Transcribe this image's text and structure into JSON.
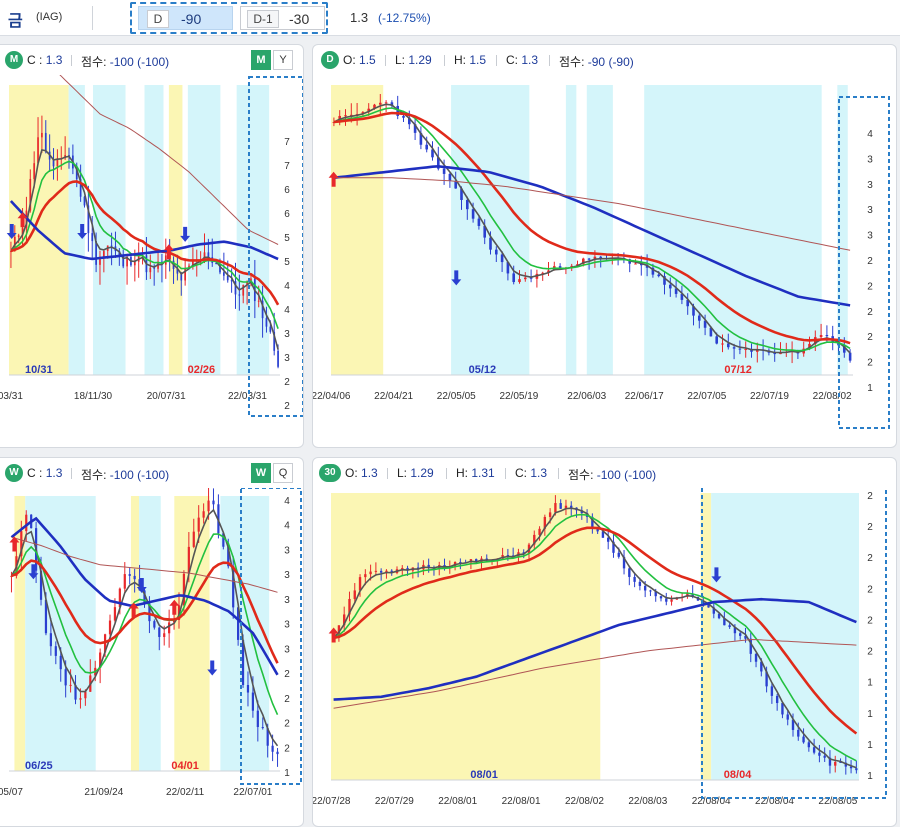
{
  "header": {
    "title": "금",
    "code": "(IAG)",
    "d_label": "D",
    "d_value": "-90",
    "d1_label": "D-1",
    "d1_value": "-30",
    "price": "1.3",
    "change": "(-12.75%)"
  },
  "colors": {
    "badge": "#2aa56b",
    "rise": "#e8282b",
    "fall": "#2a3fd0",
    "highlight_yellow": "#fbf6b4",
    "highlight_cyan": "#d4f5fa",
    "ma_gray": "#555555",
    "ma_green": "#22c040",
    "ma_red": "#e02a1a",
    "ma_blue": "#1f2fc0",
    "ma_brown": "#b05555",
    "dashed_box": "#2a7ec8"
  },
  "panels": {
    "monthly": {
      "badge": "M",
      "c_label": "C :",
      "c_value": "1.3",
      "score_label": "점수:",
      "score_value": "-100 (-100)",
      "btn_active": "M",
      "btn_other": "Y",
      "y_ticks": [
        "7",
        "7",
        "6",
        "6",
        "5",
        "5",
        "4",
        "4",
        "3",
        "3",
        "2",
        "2"
      ],
      "x_ticks": [
        "/03/31",
        "18/11/30",
        "20/07/31",
        "22/03/31"
      ],
      "markers": [
        {
          "text": "10/31",
          "color": "fall"
        },
        {
          "text": "02/26",
          "color": "rise"
        }
      ]
    },
    "daily": {
      "badge": "D",
      "o_label": "O:",
      "o_value": "1.5",
      "l_label": "L:",
      "l_value": "1.29",
      "h_label": "H:",
      "h_value": "1.5",
      "c_label": "C:",
      "c_value": "1.3",
      "score_label": "점수:",
      "score_value": "-90 (-90)",
      "y_ticks": [
        "4",
        "3",
        "3",
        "3",
        "3",
        "2",
        "2",
        "2",
        "2",
        "2",
        "1"
      ],
      "x_ticks": [
        "22/04/06",
        "22/04/21",
        "22/05/05",
        "22/05/19",
        "22/06/03",
        "22/06/17",
        "22/07/05",
        "22/07/19",
        "22/08/02"
      ],
      "markers": [
        {
          "text": "05/12",
          "color": "fall"
        },
        {
          "text": "07/12",
          "color": "rise"
        }
      ]
    },
    "weekly": {
      "badge": "W",
      "c_label": "C :",
      "c_value": "1.3",
      "score_label": "점수:",
      "score_value": "-100 (-100)",
      "btn_active": "W",
      "btn_other": "Q",
      "y_ticks": [
        "4",
        "4",
        "3",
        "3",
        "3",
        "3",
        "3",
        "2",
        "2",
        "2",
        "2",
        "1"
      ],
      "x_ticks": [
        "/05/07",
        "21/09/24",
        "22/02/11",
        "22/07/01"
      ],
      "markers": [
        {
          "text": "06/25",
          "color": "fall"
        },
        {
          "text": "04/01",
          "color": "rise"
        }
      ]
    },
    "min30": {
      "badge": "30",
      "o_label": "O:",
      "o_value": "1.3",
      "l_label": "L:",
      "l_value": "1.29",
      "h_label": "H:",
      "h_value": "1.31",
      "c_label": "C:",
      "c_value": "1.3",
      "score_label": "점수:",
      "score_value": "-100 (-100)",
      "y_ticks": [
        "2",
        "2",
        "2",
        "2",
        "2",
        "2",
        "1",
        "1",
        "1",
        "1"
      ],
      "x_ticks": [
        "22/07/28",
        "22/07/29",
        "22/08/01",
        "22/08/01",
        "22/08/02",
        "22/08/03",
        "22/08/04",
        "22/08/04",
        "22/08/05"
      ],
      "markers": [
        {
          "text": "08/01",
          "color": "fall"
        },
        {
          "text": "08/04",
          "color": "rise"
        }
      ]
    }
  }
}
